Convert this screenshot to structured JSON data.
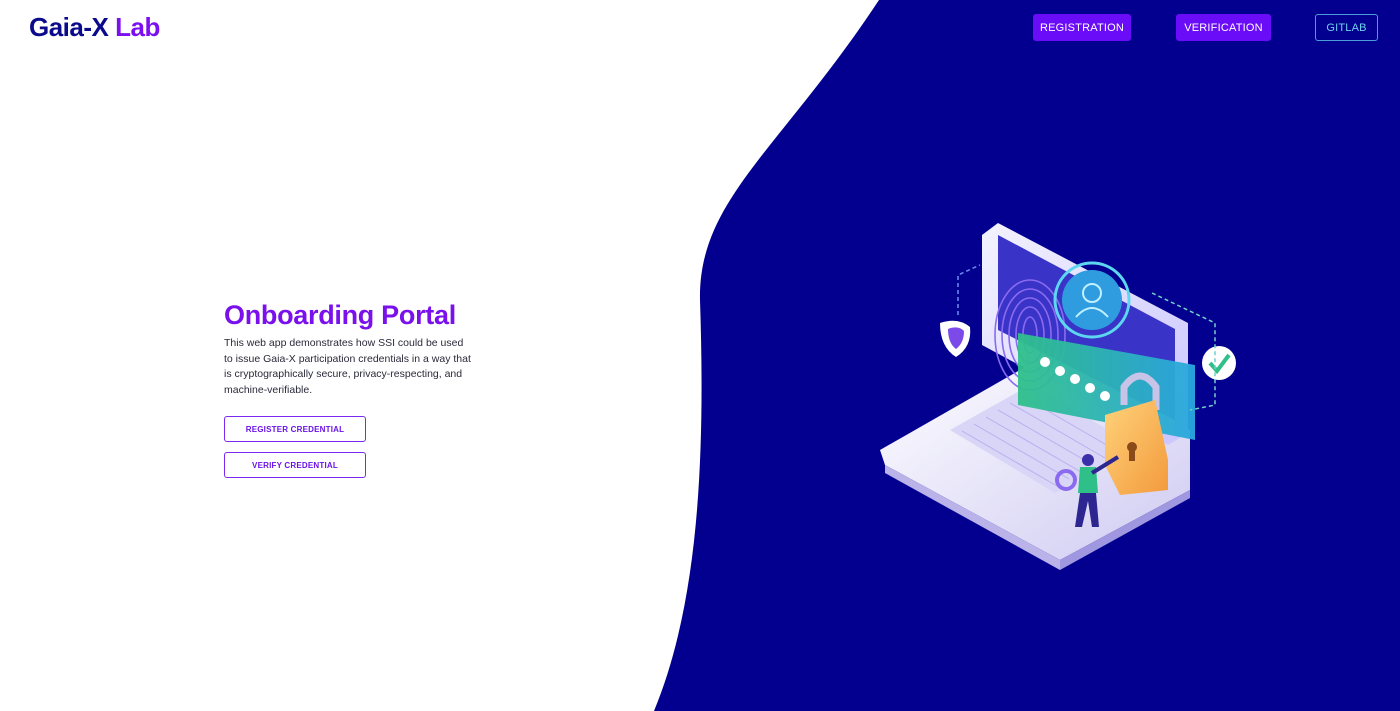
{
  "brand": {
    "name": "Gaia-X",
    "suffix": "Lab"
  },
  "nav": {
    "registration": "REGISTRATION",
    "verification": "VERIFICATION",
    "gitlab": "GITLAB"
  },
  "hero": {
    "title": "Onboarding Portal",
    "description": "This web app demonstrates how SSI could be used to issue Gaia-X participation credentials in a way that is cryptographically secure, privacy-respecting, and machine-verifiable."
  },
  "actions": {
    "register": "REGISTER CREDENTIAL",
    "verify": "VERIFY CREDENTIAL"
  },
  "colors": {
    "navy": "#03008f",
    "purple": "#6a0cf7",
    "brand_dark": "#0b0a8c",
    "accent_purple": "#7a10ec"
  },
  "illustration": {
    "icon": "laptop-security-illustration"
  }
}
